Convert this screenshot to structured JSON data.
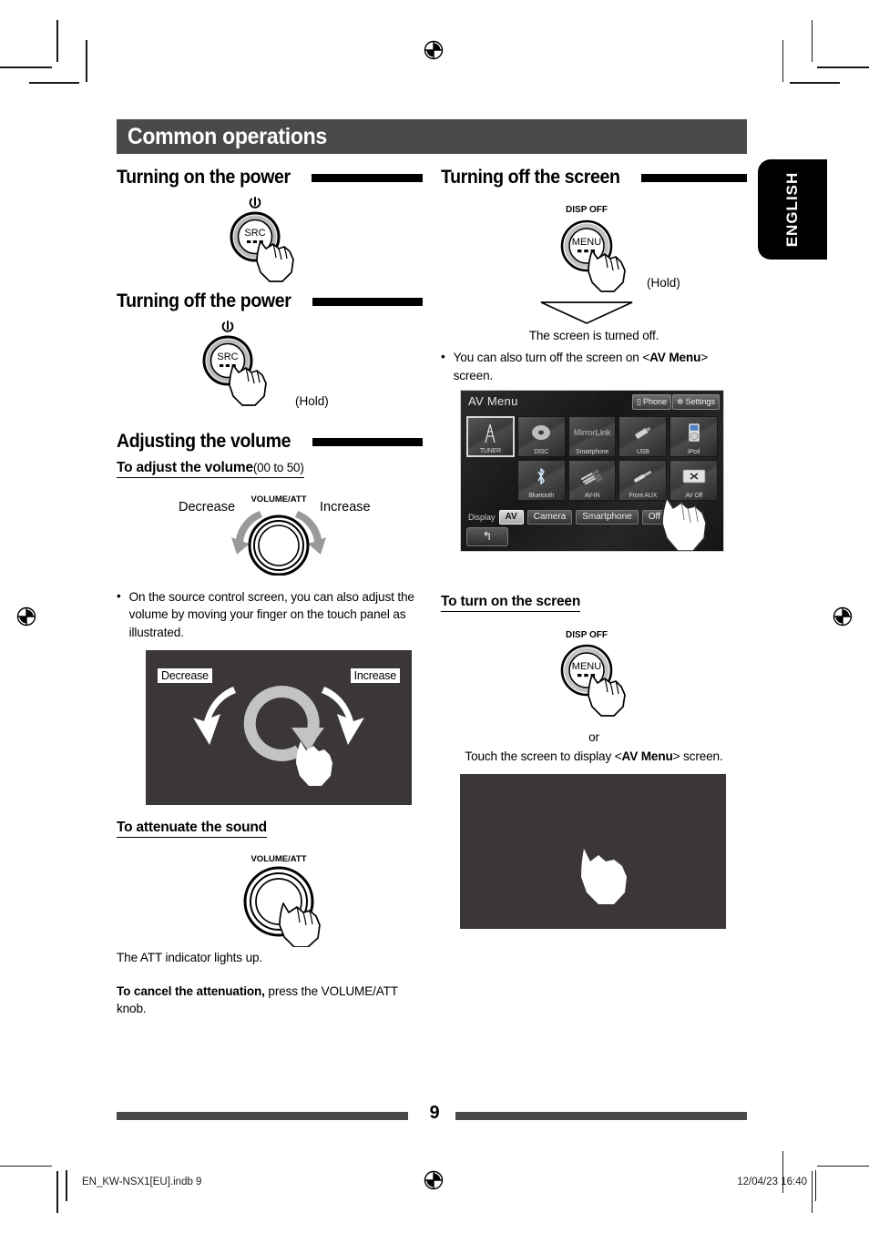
{
  "banner": {
    "title": "Common operations"
  },
  "lang_tab": {
    "label": "ENGLISH"
  },
  "left": {
    "s1": {
      "heading": "Turning on the power",
      "button_label": "SRC",
      "power_icon": "power-icon"
    },
    "s2": {
      "heading": "Turning off the power",
      "button_label": "SRC",
      "hold_note": "(Hold)"
    },
    "s3": {
      "heading": "Adjusting the volume",
      "sub1": "To adjust the volume",
      "sub1_range": "(00 to 50)",
      "knob_label": "VOLUME/ATT",
      "decrease": "Decrease",
      "increase": "Increase",
      "bullet": "On the source control screen, you can also adjust the volume by moving your finger on the touch panel as illustrated.",
      "panel_decrease": "Decrease",
      "panel_increase": "Increase",
      "sub2": "To attenuate the sound",
      "knob_label2": "VOLUME/ATT",
      "att_note": "The ATT indicator lights up.",
      "cancel_bold": "To cancel the attenuation,",
      "cancel_rest": " press the VOLUME/ATT knob."
    }
  },
  "right": {
    "s1": {
      "heading": "Turning off the screen",
      "disp_off_label": "DISP OFF",
      "button_label": "MENU",
      "hold_note": "(Hold)",
      "result": "The screen is turned off.",
      "bullet_pre": "You can also turn off the screen on <",
      "bullet_bold": "AV Menu",
      "bullet_post": "> screen."
    },
    "av_menu": {
      "title": "AV Menu",
      "phone_button": "Phone",
      "settings_button": "Settings",
      "sources_row1": [
        {
          "label": "TUNER",
          "icon": "antenna-tower-icon",
          "selected": true
        },
        {
          "label": "DISC",
          "icon": "disc-icon",
          "selected": false
        },
        {
          "label": "Smartphone",
          "icon": "mirrorlink-logo",
          "logo_text": "MirrorLink",
          "selected": false
        },
        {
          "label": "USB",
          "icon": "usb-stick-icon",
          "selected": false
        },
        {
          "label": "iPod",
          "icon": "ipod-icon",
          "selected": false
        }
      ],
      "sources_row2": [
        {
          "label": "Bluetooth",
          "icon": "bluetooth-icon",
          "selected": false
        },
        {
          "label": "AV-IN",
          "icon": "rca-cables-icon",
          "selected": false
        },
        {
          "label": "Front AUX",
          "icon": "aux-plug-icon",
          "selected": false
        },
        {
          "label": "AV Off",
          "icon": "x-icon",
          "selected": false
        }
      ],
      "display_label": "Display",
      "display_buttons": [
        {
          "label": "AV",
          "selected": true
        },
        {
          "label": "Camera",
          "selected": false
        },
        {
          "label": "Smartphone",
          "selected": false
        },
        {
          "label": "Off",
          "selected": false
        }
      ],
      "back_button": "back-arrow-icon"
    },
    "s2": {
      "heading": "To turn on the screen",
      "disp_off_label": "DISP OFF",
      "button_label": "MENU",
      "or": "or",
      "touch_pre": "Touch the screen to display <",
      "touch_bold": "AV Menu",
      "touch_post": "> screen."
    }
  },
  "footer": {
    "page_number": "9",
    "file_name": "EN_KW-NSX1[EU].indb   9",
    "timestamp": "12/04/23   16:40"
  }
}
